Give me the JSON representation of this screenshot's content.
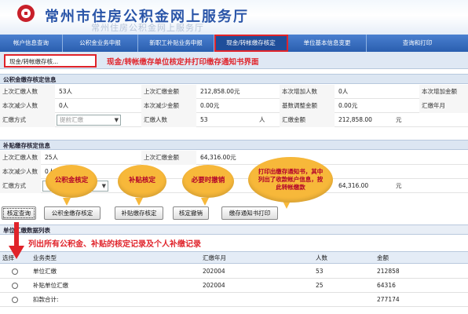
{
  "header": {
    "title": "常州市住房公积金网上服务厅",
    "title_ghost": "常州住房公积金网上服务厅"
  },
  "nav": {
    "tabs": [
      "帐户信息查询",
      "公积金业务申报",
      "新职工补贴业务申报",
      "现金/转帐缴存核定",
      "单位基本信息变更",
      "查询和打印"
    ]
  },
  "subtab": {
    "label": "现金/转帐缴存核..."
  },
  "notes": {
    "page": "现金/转帐缴存单位核定并打印缴存通知书界面",
    "table": "列出所有公积金、补贴的核定记录及个人补缴记录"
  },
  "section1": {
    "title": "公积金缴存核定信息",
    "rows": [
      {
        "l1": "上次汇缴人数",
        "v1": "53人",
        "l2": "上次汇缴金额",
        "v2": "212,858.00元",
        "l3": "本次增加人数",
        "v3": "0人",
        "l4": "本次增加金额"
      },
      {
        "l1": "本次减少人数",
        "v1": "0人",
        "l2": "本次减少金额",
        "v2": "0.00元",
        "l3": "基数调整金额",
        "v3": "0.00元",
        "l4": "汇缴年月"
      },
      {
        "l1": "汇缴方式",
        "sel": "提前汇缴",
        "l2": "汇缴人数",
        "v2": "53",
        "u2": "人",
        "l3": "汇缴金额",
        "v3": "212,858.00",
        "u3": "元"
      }
    ]
  },
  "section2": {
    "title": "补贴缴存核定信息",
    "rows": [
      {
        "l1": "上次汇缴人数",
        "v1": "25人",
        "l2": "上次汇缴金额",
        "v2": "64,316.00元"
      },
      {
        "l1": "本次减少人数",
        "v1": "0人"
      },
      {
        "l1": "汇缴方式",
        "v3": "64,316.00",
        "u3": "元"
      }
    ]
  },
  "buttons": [
    "核定查询",
    "公积金缴存核定",
    "补贴缴存核定",
    "核定撤销",
    "缴存通知书打印"
  ],
  "table": {
    "title": "单位汇缴数据列表",
    "headers": [
      "选择",
      "业务类型",
      "汇缴年月",
      "人数",
      "金额"
    ],
    "rows": [
      {
        "type": "单位汇缴",
        "month": "202004",
        "count": "53",
        "amount": "212858",
        "selected": true
      },
      {
        "type": "补贴单位汇缴",
        "month": "202004",
        "count": "25",
        "amount": "64316",
        "selected": false
      },
      {
        "type": "扣款合计:",
        "month": "",
        "count": "",
        "amount": "277174",
        "selected": false
      }
    ]
  },
  "callouts": {
    "b1": "公积金核定",
    "b2": "补贴核定",
    "b3": "必要时撤销",
    "b4": "打印出缴存通知书，其中列出了收款帐户信息，按此转帐缴款"
  },
  "colors": {
    "accent_red": "#e0232a",
    "nav_blue": "#2a5eaf",
    "bubble": "#f7b83a"
  }
}
